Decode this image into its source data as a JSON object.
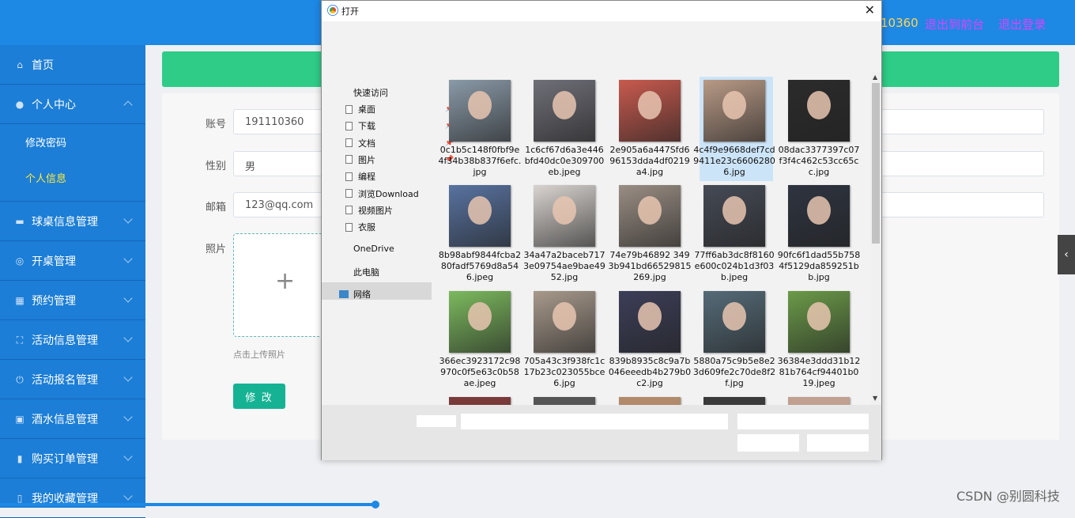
{
  "header": {
    "user_id": "10360",
    "back_front": "退出到前台",
    "logout": "退出登录"
  },
  "sidebar": {
    "items": [
      {
        "label": "首页",
        "icon": "home-icon",
        "chev": false
      },
      {
        "label": "个人中心",
        "icon": "user-icon",
        "chev": "up",
        "subs": [
          {
            "label": "修改密码",
            "active": false
          },
          {
            "label": "个人信息",
            "active": true
          }
        ]
      },
      {
        "label": "球桌信息管理",
        "icon": "table-icon",
        "chev": "down"
      },
      {
        "label": "开桌管理",
        "icon": "settings-icon",
        "chev": "down"
      },
      {
        "label": "预约管理",
        "icon": "grid-icon",
        "chev": "down"
      },
      {
        "label": "活动信息管理",
        "icon": "frame-icon",
        "chev": "down"
      },
      {
        "label": "活动报名管理",
        "icon": "power-icon",
        "chev": "down"
      },
      {
        "label": "酒水信息管理",
        "icon": "briefcase-icon",
        "chev": "down"
      },
      {
        "label": "购买订单管理",
        "icon": "bar-chart-icon",
        "chev": "down"
      },
      {
        "label": "我的收藏管理",
        "icon": "phone-icon",
        "chev": "down"
      }
    ]
  },
  "form": {
    "account_label": "账号",
    "account_value": "191110360",
    "gender_label": "性别",
    "gender_value": "男",
    "email_label": "邮箱",
    "email_value": "123@qq.com",
    "photo_label": "照片",
    "upload_plus": "+",
    "upload_hint": "点击上传照片",
    "submit": "修 改"
  },
  "right_toggle": "‹",
  "watermark": "CSDN @别圆科技",
  "dialog": {
    "title": "打开",
    "close": "✕",
    "quick_access": "快速访问",
    "tree": [
      {
        "label": "桌面",
        "pinned": true
      },
      {
        "label": "下载",
        "pinned": true
      },
      {
        "label": "文档",
        "pinned": true
      },
      {
        "label": "图片",
        "pinned": true
      },
      {
        "label": "编程",
        "pinned": false
      },
      {
        "label": "浏览Download",
        "pinned": false
      },
      {
        "label": "视频图片",
        "pinned": false
      },
      {
        "label": "衣服",
        "pinned": false
      }
    ],
    "onedrive": "OneDrive",
    "this_pc": "此电脑",
    "network": "网络",
    "pin_glyph": "📌",
    "files": [
      {
        "name": "0c1b5c148f0fbf9e4f34b38b837f6efc.jpg",
        "color": "#8a9aa8"
      },
      {
        "name": "1c6cf67d6a3e446bfd40dc0e309700eb.jpeg",
        "color": "#6f6f78"
      },
      {
        "name": "2e905a6a447Sfd696153dda4df0219a4.jpg",
        "color": "#c85a4e"
      },
      {
        "name": "4c4f9e9668def7cd9411e23c66062806.jpg",
        "color": "#b89a86"
      },
      {
        "name": "08dac3377397c07f3f4c462c53cc65cc.jpg",
        "color": "#2b2b2b"
      },
      {
        "name": "8b98abf9844fcba280fadf5769d8a546.jpeg",
        "color": "#5873a0"
      },
      {
        "name": "34a47a2baceb7173e09754ae9bae4952.jpg",
        "color": "#d9d4d0"
      },
      {
        "name": "74e79b46892 3493b941bd66529815269.jpg",
        "color": "#9a8e84"
      },
      {
        "name": "77ff6ab3dc8f8160e600c024b1d3f03b.jpeg",
        "color": "#454a55"
      },
      {
        "name": "90fc6f1dad55b7584f5129da859251bb.jpg",
        "color": "#2e3440"
      },
      {
        "name": "366ec3923172c98970c0f5e63c0b58ae.jpeg",
        "color": "#7cba5e"
      },
      {
        "name": "705a43c3f938fc1c17b23c023055bce6.jpg",
        "color": "#a89a8c"
      },
      {
        "name": "839b8935c8c9a7b046eeedb4b279b0c2.jpg",
        "color": "#3c3e58"
      },
      {
        "name": "5880a75c9b5e8e23d609fe2c70de8f2f.jpg",
        "color": "#556b78"
      },
      {
        "name": "36384e3ddd31b1281b764cf94401b019.jpeg",
        "color": "#6b9a48"
      }
    ],
    "partial_colors": [
      "#7a3a3a",
      "#555",
      "#b08a6a",
      "#3a3a3a",
      "#c0a090"
    ],
    "scroll_up": "▲",
    "scroll_down": "▼"
  }
}
